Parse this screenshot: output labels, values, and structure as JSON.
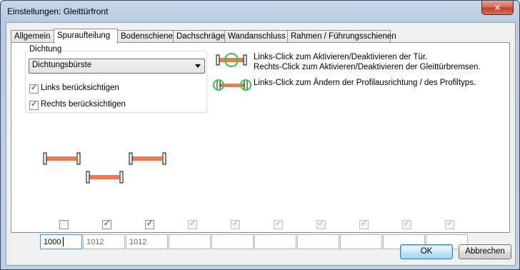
{
  "window": {
    "title": "Einstellungen: Gleittürfront"
  },
  "tabs": [
    {
      "label": "Allgemein",
      "active": false
    },
    {
      "label": "Spuraufteilung",
      "active": true
    },
    {
      "label": "Bodenschiene",
      "active": false
    },
    {
      "label": "Dachschräge",
      "active": false
    },
    {
      "label": "Wandanschluss",
      "active": false
    },
    {
      "label": "Rahmen / Führungsschienen",
      "active": false
    }
  ],
  "dichtung": {
    "group_label": "Dichtung",
    "selected": "Dichtungsbürste",
    "links_label": "Links berücksichtigen",
    "links_checked": true,
    "rechts_label": "Rechts berücksichtigen",
    "rechts_checked": true
  },
  "help": {
    "line1": "Links-Click zum Aktivieren/Deaktivieren der Tür.",
    "line2": "Rechts-Click zum Aktivieren/Deaktivieren der Gleittürbremsen.",
    "line3": "Links-Click zum Ändern der Profilausrichtung / des Profiltyps."
  },
  "tracks": [
    {
      "checked": false,
      "enabled": true,
      "value": "1000",
      "focused": true
    },
    {
      "checked": true,
      "enabled": true,
      "value": "1012",
      "focused": false
    },
    {
      "checked": true,
      "enabled": true,
      "value": "1012",
      "focused": false
    },
    {
      "checked": true,
      "enabled": false,
      "value": "",
      "focused": false
    },
    {
      "checked": true,
      "enabled": false,
      "value": "",
      "focused": false
    },
    {
      "checked": true,
      "enabled": false,
      "value": "",
      "focused": false
    },
    {
      "checked": true,
      "enabled": false,
      "value": "",
      "focused": false
    },
    {
      "checked": true,
      "enabled": false,
      "value": "",
      "focused": false
    },
    {
      "checked": true,
      "enabled": false,
      "value": "",
      "focused": false
    },
    {
      "checked": true,
      "enabled": false,
      "value": "",
      "focused": false
    }
  ],
  "buttons": {
    "ok": "OK",
    "cancel": "Abbrechen"
  },
  "colors": {
    "door_bar": "#ef7a4e",
    "highlight_ring": "#35c84a",
    "close_button": "#c9452d"
  },
  "icons": {
    "close": "close-icon",
    "dropdown": "chevron-down-icon"
  }
}
